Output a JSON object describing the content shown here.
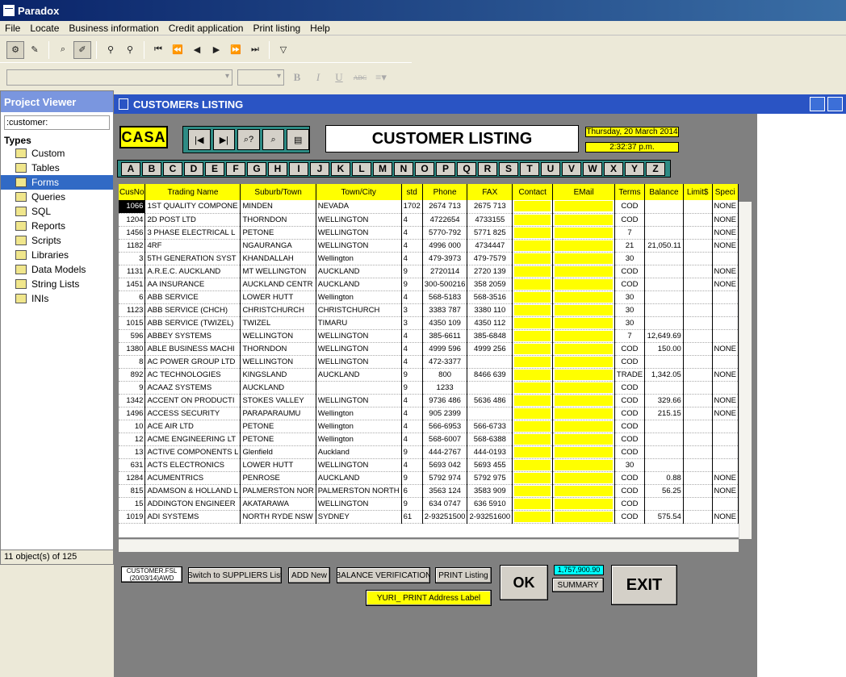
{
  "app": {
    "title": "Paradox",
    "menu": [
      "File",
      "Locate",
      "Business information",
      "Credit application",
      "Print listing",
      "Help"
    ]
  },
  "project_viewer": {
    "title": "Project Viewer",
    "alias": ":customer:",
    "types_label": "Types",
    "items": [
      "Custom",
      "Tables",
      "Forms",
      "Queries",
      "SQL",
      "Reports",
      "Scripts",
      "Libraries",
      "Data Models",
      "String Lists",
      "INIs"
    ],
    "selected": "Forms",
    "status": "11 object(s) of 125"
  },
  "form": {
    "window_title": "CUSTOMERs LISTING",
    "logo": "CASA",
    "heading": "CUSTOMER LISTING",
    "date": "Thursday, 20 March 2014",
    "time": "2:32:37 p.m.",
    "letters": [
      "A",
      "B",
      "C",
      "D",
      "E",
      "F",
      "G",
      "H",
      "I",
      "J",
      "K",
      "L",
      "M",
      "N",
      "O",
      "P",
      "Q",
      "R",
      "S",
      "T",
      "U",
      "V",
      "W",
      "X",
      "Y",
      "Z"
    ],
    "columns": [
      "CusNo",
      "Trading Name",
      "Suburb/Town",
      "Town/City",
      "std",
      "Phone",
      "FAX",
      "Contact",
      "EMail",
      "Terms",
      "Balance",
      "Limit$",
      "Speci"
    ],
    "rows": [
      [
        "1066",
        "1ST QUALITY COMPONE",
        "MINDEN",
        "NEVADA",
        "1702",
        "2674 713",
        "2675 713",
        "",
        "",
        "COD",
        "",
        "",
        "NONE"
      ],
      [
        "1204",
        "2D POST LTD",
        "THORNDON",
        "WELLINGTON",
        "4",
        "4722654",
        "4733155",
        "",
        "",
        "COD",
        "",
        "",
        "NONE"
      ],
      [
        "1456",
        "3 PHASE ELECTRICAL L",
        "PETONE",
        "WELLINGTON",
        "4",
        "5770-792",
        "5771 825",
        "",
        "",
        "7",
        "",
        "",
        "NONE"
      ],
      [
        "1182",
        "4RF",
        "NGAURANGA",
        "WELLINGTON",
        "4",
        "4996 000",
        "4734447",
        "",
        "",
        "21",
        "21,050.11",
        "",
        "NONE"
      ],
      [
        "3",
        "5TH GENERATION SYST",
        "KHANDALLAH",
        "Wellington",
        "4",
        "479-3973",
        "479-7579",
        "",
        "",
        "30",
        "",
        "",
        ""
      ],
      [
        "1131",
        "A.R.E.C. AUCKLAND",
        "MT WELLINGTON",
        "AUCKLAND",
        "9",
        "2720114",
        "2720 139",
        "",
        "",
        "COD",
        "",
        "",
        "NONE"
      ],
      [
        "1451",
        "AA INSURANCE",
        "AUCKLAND CENTR",
        "AUCKLAND",
        "9",
        "300-500216",
        "358 2059",
        "",
        "",
        "COD",
        "",
        "",
        "NONE"
      ],
      [
        "6",
        "ABB SERVICE",
        "LOWER HUTT",
        "Wellington",
        "4",
        "568-5183",
        "568-3516",
        "",
        "",
        "30",
        "",
        "",
        ""
      ],
      [
        "1123",
        "ABB SERVICE (CHCH)",
        "CHRISTCHURCH",
        "CHRISTCHURCH",
        "3",
        "3383 787",
        "3380 110",
        "",
        "",
        "30",
        "",
        "",
        ""
      ],
      [
        "1015",
        "ABB SERVICE (TWIZEL)",
        "TWIZEL",
        "TIMARU",
        "3",
        "4350 109",
        "4350 112",
        "",
        "",
        "30",
        "",
        "",
        ""
      ],
      [
        "596",
        "ABBEY SYSTEMS",
        "WELLINGTON",
        "WELLINGTON",
        "4",
        "385-6611",
        "385-6848",
        "",
        "",
        "7",
        "12,649.69",
        "",
        ""
      ],
      [
        "1380",
        "ABLE BUSINESS MACHI",
        "THORNDON",
        "WELLINGTON",
        "4",
        "4999 596",
        "4999 256",
        "",
        "",
        "COD",
        "150.00",
        "",
        "NONE"
      ],
      [
        "8",
        "AC POWER GROUP LTD",
        "WELLINGTON",
        "WELLINGTON",
        "4",
        "472-3377",
        "",
        "",
        "",
        "COD",
        "",
        "",
        ""
      ],
      [
        "892",
        "AC TECHNOLOGIES",
        "KINGSLAND",
        "AUCKLAND",
        "9",
        "800",
        "8466 639",
        "",
        "",
        "TRADE",
        "1,342.05",
        "",
        "NONE"
      ],
      [
        "9",
        "ACAAZ SYSTEMS",
        "AUCKLAND",
        "",
        "9",
        "1233",
        "",
        "",
        "",
        "COD",
        "",
        "",
        ""
      ],
      [
        "1342",
        "ACCENT ON PRODUCTI",
        "STOKES VALLEY",
        "WELLINGTON",
        "4",
        "9736 486",
        "5636 486",
        "",
        "",
        "COD",
        "329.66",
        "",
        "NONE"
      ],
      [
        "1496",
        "ACCESS SECURITY",
        "PARAPARAUMU",
        "Wellington",
        "4",
        "905 2399",
        "",
        "",
        "",
        "COD",
        "215.15",
        "",
        "NONE"
      ],
      [
        "10",
        "ACE AIR LTD",
        "PETONE",
        "Wellington",
        "4",
        "566-6953",
        "566-6733",
        "",
        "",
        "COD",
        "",
        "",
        ""
      ],
      [
        "12",
        "ACME ENGINEERING LT",
        "PETONE",
        "Wellington",
        "4",
        "568-6007",
        "568-6388",
        "",
        "",
        "COD",
        "",
        "",
        ""
      ],
      [
        "13",
        "ACTIVE COMPONENTS L",
        "Glenfield",
        "Auckland",
        "9",
        "444-2767",
        "444-0193",
        "",
        "",
        "COD",
        "",
        "",
        ""
      ],
      [
        "631",
        "ACTS ELECTRONICS",
        "LOWER HUTT",
        "WELLINGTON",
        "4",
        "5693 042",
        "5693 455",
        "",
        "",
        "30",
        "",
        "",
        ""
      ],
      [
        "1284",
        "ACUMENTRICS",
        "PENROSE",
        "AUCKLAND",
        "9",
        "5792 974",
        "5792 975",
        "",
        "",
        "COD",
        "0.88",
        "",
        "NONE"
      ],
      [
        "815",
        "ADAMSON & HOLLAND L",
        "PALMERSTON NOR",
        "PALMERSTON NORTH",
        "6",
        "3563 124",
        "3583 909",
        "",
        "",
        "COD",
        "56.25",
        "",
        "NONE"
      ],
      [
        "15",
        "ADDINGTON ENGINEER",
        "AKATARAWA",
        "WELLINGTON",
        "9",
        "634 0747",
        "636 5910",
        "",
        "",
        "COD",
        "",
        "",
        ""
      ],
      [
        "1019",
        "ADI SYSTEMS",
        "NORTH RYDE NSW",
        "SYDNEY",
        "61",
        "2-93251500",
        "2-93251600",
        "",
        "",
        "COD",
        "575.54",
        "",
        "NONE"
      ]
    ],
    "bottom": {
      "file_label": "CUSTOMER.FSL",
      "file_sub": "(20/03/14)AWD",
      "switch": "Switch to SUPPLIERS List",
      "add": "ADD New",
      "balance": "BALANCE VERIFICATION",
      "print": "PRINT Listing",
      "ok": "OK",
      "total": "1,757,900.90",
      "summary": "SUMMARY",
      "exit": "EXIT",
      "yuri": "YURI_ PRINT Address Label"
    }
  }
}
